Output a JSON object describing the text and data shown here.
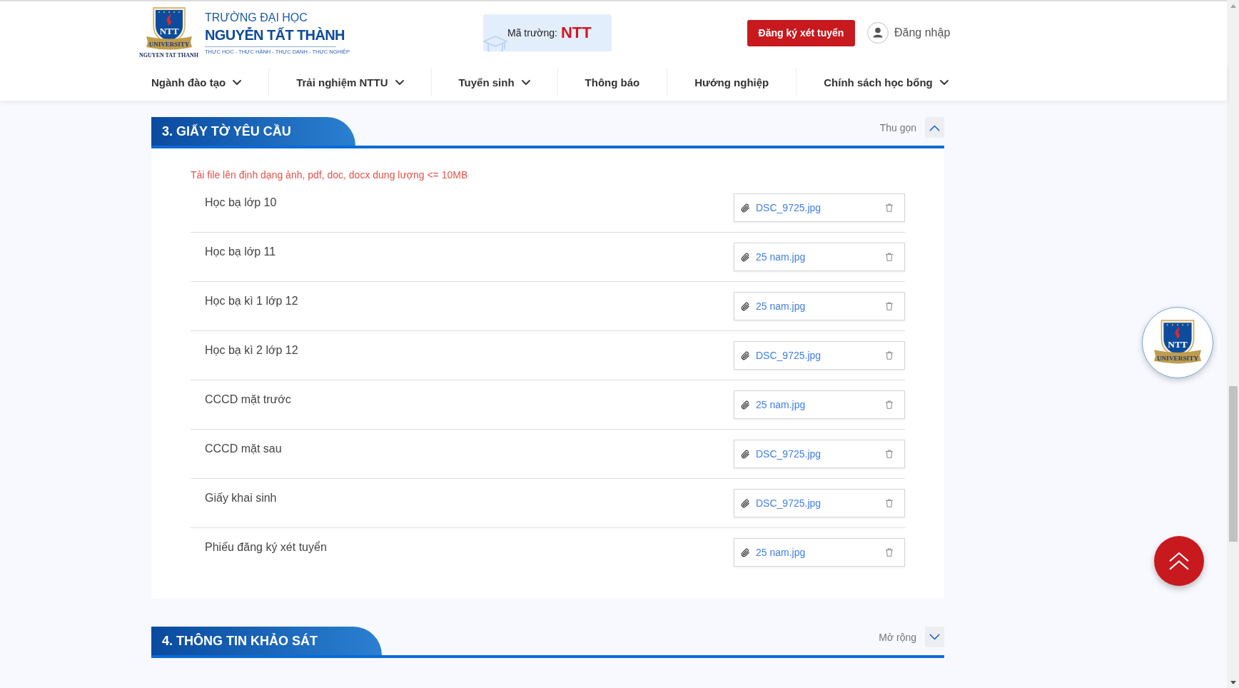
{
  "header": {
    "logo": {
      "monogram": "NTT",
      "ribbon": "UNIVERSITY",
      "caption": "NGUYEN TAT THANH"
    },
    "school_type": "TRƯỜNG ĐẠI HỌC",
    "school_name": "NGUYỄN TẤT THÀNH",
    "tagline": "THỰC HỌC - THỰC HÀNH - THỰC DANH - THỰC NGHIỆP",
    "school_code": {
      "label": "Mã trường:",
      "value": "NTT"
    },
    "register_button": "Đăng ký xét tuyển",
    "login": "Đăng nhập"
  },
  "nav": [
    {
      "label": "Ngành đào tạo",
      "has_dropdown": true
    },
    {
      "label": "Trải nghiệm NTTU",
      "has_dropdown": true
    },
    {
      "label": "Tuyển sinh",
      "has_dropdown": true
    },
    {
      "label": "Thông báo",
      "has_dropdown": false
    },
    {
      "label": "Hướng nghiệp",
      "has_dropdown": false
    },
    {
      "label": "Chính sách học bổng",
      "has_dropdown": true
    }
  ],
  "sections": [
    {
      "title": "3. GIẤY TỜ YÊU CẦU",
      "toggle_label": "Thu gọn",
      "expanded": true,
      "note": "Tải file lên định dạng ảnh, pdf, doc, docx dung lượng <= 10MB",
      "documents": [
        {
          "label": "Học bạ lớp 10",
          "file": "DSC_9725.jpg"
        },
        {
          "label": "Học bạ lớp 11",
          "file": "25 nam.jpg"
        },
        {
          "label": "Học bạ kì 1 lớp 12",
          "file": "25 nam.jpg"
        },
        {
          "label": "Học bạ kì 2 lớp 12",
          "file": "DSC_9725.jpg"
        },
        {
          "label": "CCCD mặt trước",
          "file": "25 nam.jpg"
        },
        {
          "label": "CCCD mặt sau",
          "file": "DSC_9725.jpg"
        },
        {
          "label": "Giấy khai sinh",
          "file": "DSC_9725.jpg"
        },
        {
          "label": "Phiếu đăng ký xét tuyển",
          "file": "25 nam.jpg"
        }
      ]
    },
    {
      "title": "4. THÔNG TIN KHẢO SÁT",
      "toggle_label": "Mở rộng",
      "expanded": false
    }
  ],
  "floating_badge": {
    "monogram": "NTT",
    "ribbon": "UNIVERSITY"
  }
}
